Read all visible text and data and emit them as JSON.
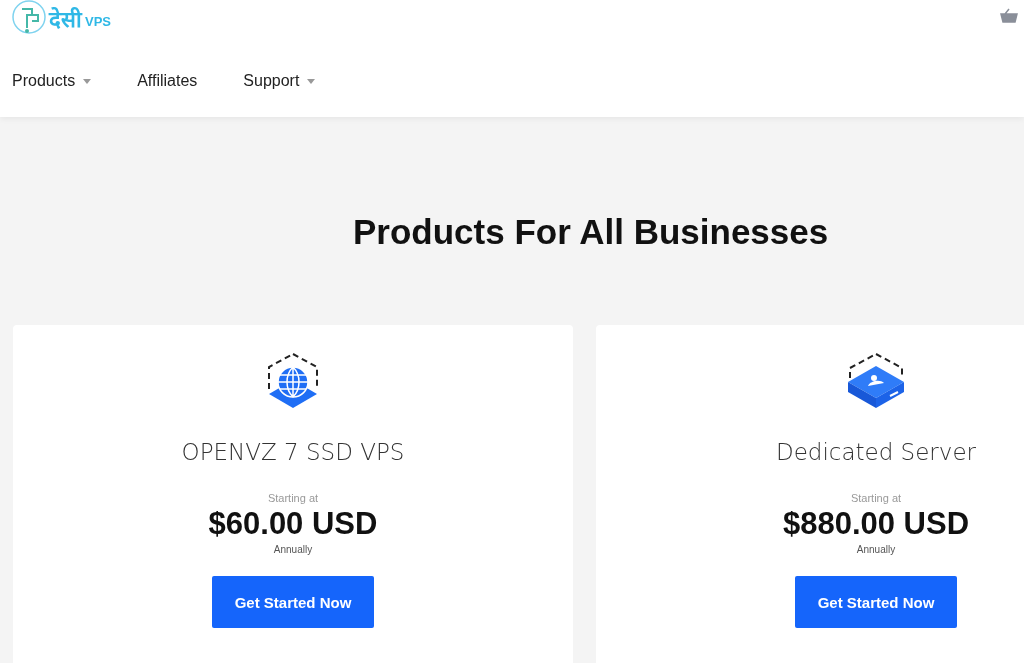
{
  "header": {
    "logo": {
      "script_text": "देसी",
      "latin_text": "VPS"
    },
    "nav": [
      {
        "label": "Products",
        "dropdown": true
      },
      {
        "label": "Affiliates",
        "dropdown": false
      },
      {
        "label": "Support",
        "dropdown": true
      }
    ]
  },
  "section": {
    "title": "Products For All Businesses"
  },
  "products": [
    {
      "kind": "globe",
      "name": "OPENVZ 7 SSD VPS",
      "starting": "Starting at",
      "price": "$60.00 USD",
      "cycle": "Annually",
      "button": "Get Started Now"
    },
    {
      "kind": "server",
      "name": "Dedicated Server",
      "starting": "Starting at",
      "price": "$880.00 USD",
      "cycle": "Annually",
      "button": "Get Started Now"
    }
  ]
}
